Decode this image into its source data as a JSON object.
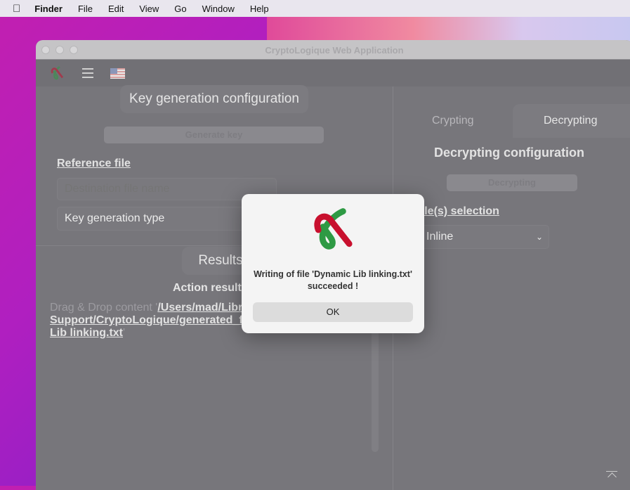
{
  "menubar": {
    "app": "Finder",
    "items": [
      "File",
      "Edit",
      "View",
      "Go",
      "Window",
      "Help"
    ]
  },
  "window": {
    "title": "CryptoLogique Web Application"
  },
  "left": {
    "key_tab": "Key generation configuration",
    "generate_button": "Generate key",
    "reference_file": "Reference file",
    "destination_placeholder": "Destination file name",
    "key_type": "Key generation type",
    "results_tab": "Results",
    "action_results": "Action results",
    "drop_prefix": "Drag & Drop content '",
    "drop_path_1": "/Users/mad/Libr",
    "drop_path_2": "Support/CryptoLogique/generated_f",
    "drop_path_3": "Lib linking.txt",
    "drop_suffix": "'"
  },
  "right": {
    "tabs": [
      {
        "label": "Crypting",
        "active": false
      },
      {
        "label": "Decrypting",
        "active": true
      }
    ],
    "config_title": "Decrypting configuration",
    "decrypt_button": "Decrypting",
    "files_selection": "File(s) selection",
    "mode_select": "Inline"
  },
  "dialog": {
    "message": "Writing of file 'Dynamic Lib linking.txt' succeeded !",
    "ok": "OK"
  },
  "colors": {
    "logo_red": "#c8102e",
    "logo_green": "#2e9a44"
  }
}
